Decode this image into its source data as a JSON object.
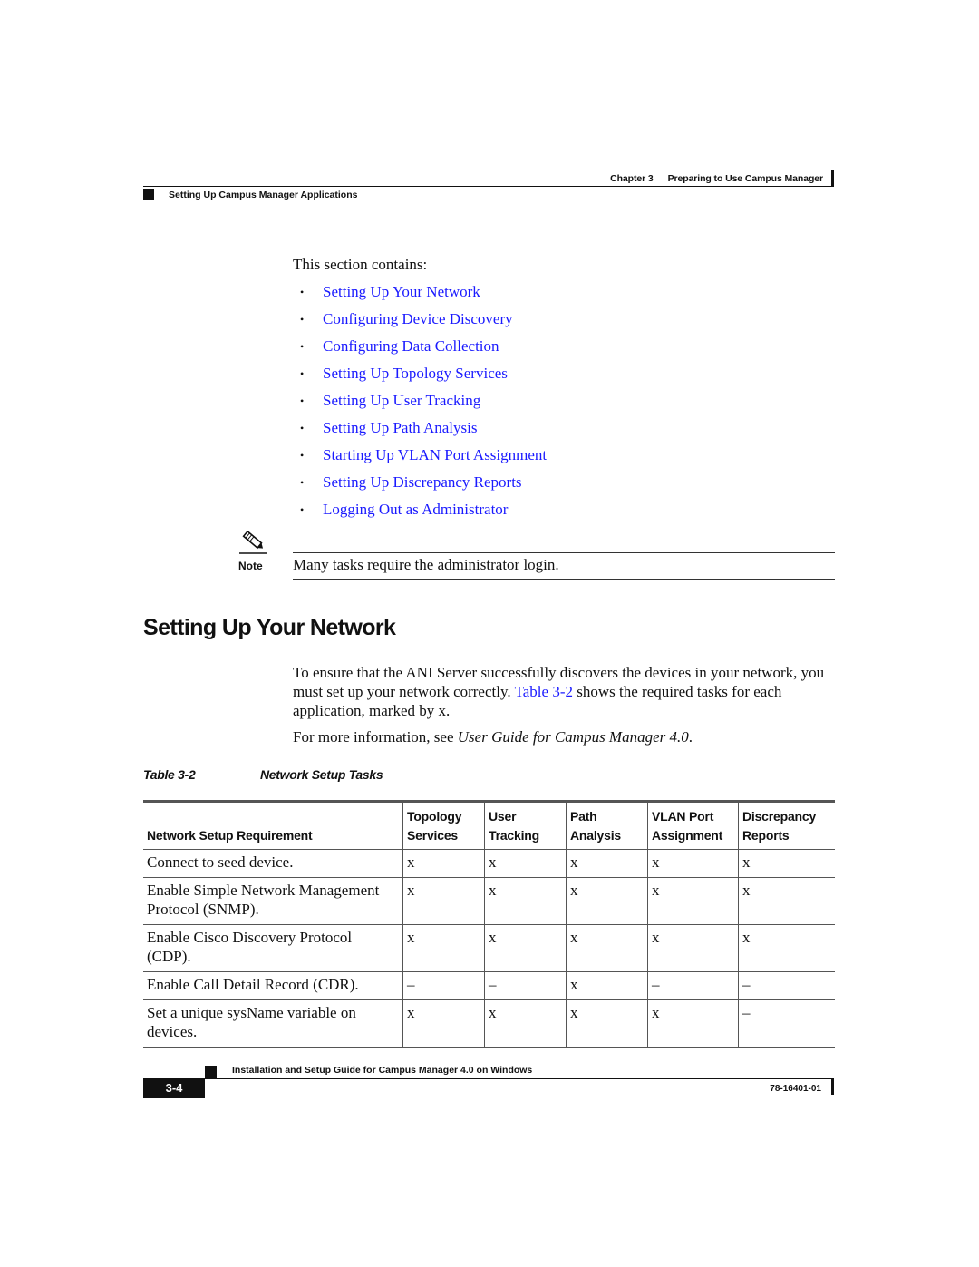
{
  "header": {
    "chapter_label": "Chapter 3",
    "chapter_title": "Preparing to Use Campus Manager",
    "section_title": "Setting Up Campus Manager Applications"
  },
  "intro": {
    "lead": "This section contains:",
    "links": [
      "Setting Up Your Network",
      "Configuring Device Discovery",
      "Configuring Data Collection",
      "Setting Up Topology Services",
      "Setting Up User Tracking",
      "Setting Up Path Analysis",
      "Starting Up VLAN Port Assignment",
      "Setting Up Discrepancy Reports",
      "Logging Out as Administrator"
    ],
    "bullet": "•"
  },
  "note": {
    "icon": "pencil-note-icon",
    "label": "Note",
    "text": "Many tasks require the administrator login."
  },
  "section": {
    "heading": "Setting Up Your Network",
    "para1_a": "To ensure that the ANI Server successfully discovers the devices in your network, you must set up your network correctly. ",
    "para1_link": "Table 3-2",
    "para1_b": " shows the required tasks for each application, marked by x.",
    "para2_a": "For more information, see ",
    "para2_italic": "User Guide for Campus Manager 4.0",
    "para2_b": "."
  },
  "table": {
    "caption_label": "Table 3-2",
    "caption_title": "Network Setup Tasks",
    "headers": [
      {
        "line1": "",
        "line2": "Network Setup Requirement"
      },
      {
        "line1": "Topology",
        "line2": "Services"
      },
      {
        "line1": "User",
        "line2": "Tracking"
      },
      {
        "line1": "Path",
        "line2": "Analysis"
      },
      {
        "line1": "VLAN Port",
        "line2": "Assignment"
      },
      {
        "line1": "Discrepancy",
        "line2": "Reports"
      }
    ],
    "rows": [
      [
        "Connect to seed device.",
        "x",
        "x",
        "x",
        "x",
        "x"
      ],
      [
        "Enable Simple Network Management Protocol (SNMP).",
        "x",
        "x",
        "x",
        "x",
        "x"
      ],
      [
        "Enable Cisco Discovery Protocol (CDP).",
        "x",
        "x",
        "x",
        "x",
        "x"
      ],
      [
        "Enable Call Detail Record (CDR).",
        "–",
        "–",
        "x",
        "–",
        "–"
      ],
      [
        "Set a unique sysName variable on devices.",
        "x",
        "x",
        "x",
        "x",
        "–"
      ]
    ]
  },
  "footer": {
    "guide_title": "Installation and Setup Guide for Campus Manager 4.0 on Windows",
    "page_number": "3-4",
    "doc_number": "78-16401-01"
  }
}
